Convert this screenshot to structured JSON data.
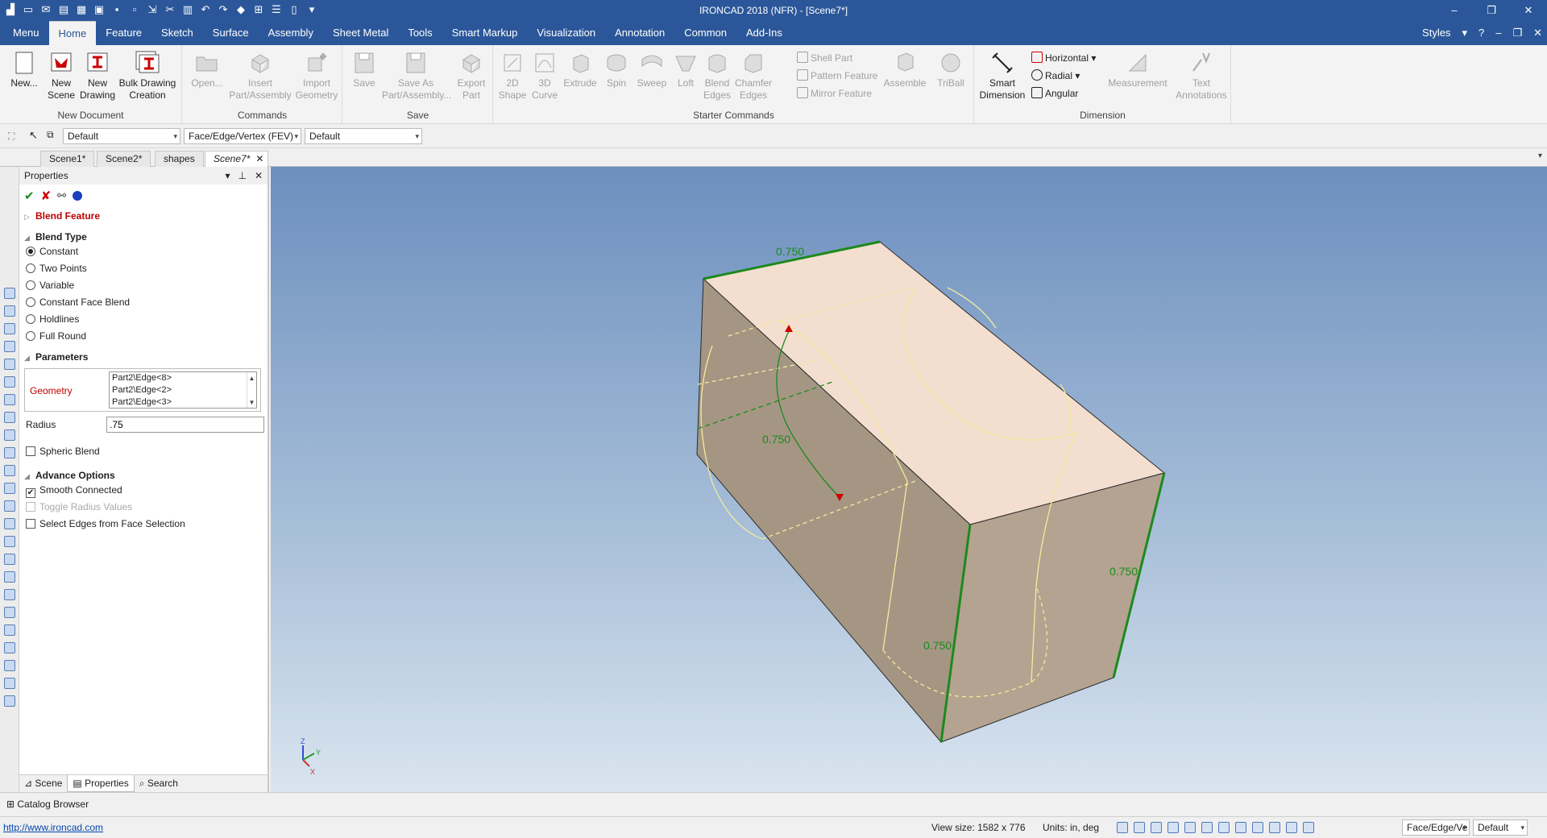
{
  "window": {
    "title": "IRONCAD 2018 (NFR) - [Scene7*]",
    "controls": [
      "–",
      "❐",
      "✕"
    ]
  },
  "ribbon_tabs": [
    "Menu",
    "Home",
    "Feature",
    "Sketch",
    "Surface",
    "Assembly",
    "Sheet Metal",
    "Tools",
    "Smart Markup",
    "Visualization",
    "Annotation",
    "Common",
    "Add-Ins"
  ],
  "ribbon_right": {
    "styles": "Styles"
  },
  "groups": {
    "new_document": {
      "label": "New Document",
      "new": "New...",
      "new_scene": [
        "New",
        "Scene"
      ],
      "new_drawing": [
        "New",
        "Drawing"
      ],
      "bulk_drawing": [
        "Bulk Drawing",
        "Creation"
      ]
    },
    "commands": {
      "label": "Commands",
      "open": "Open...",
      "insert": [
        "Insert",
        "Part/Assembly"
      ],
      "import": [
        "Import",
        "Geometry"
      ]
    },
    "save": {
      "label": "Save",
      "save": "Save",
      "save_as": [
        "Save As",
        "Part/Assembly..."
      ],
      "export": [
        "Export",
        "Part"
      ]
    },
    "starter": {
      "label": "Starter Commands",
      "shape2d": [
        "2D",
        "Shape"
      ],
      "curve3d": [
        "3D",
        "Curve"
      ],
      "extrude": "Extrude",
      "spin": "Spin",
      "sweep": "Sweep",
      "loft": "Loft",
      "blend_edges": [
        "Blend",
        "Edges"
      ],
      "chamfer_edges": [
        "Chamfer",
        "Edges"
      ],
      "shell_part": "Shell Part",
      "pattern_feature": "Pattern Feature",
      "mirror_feature": "Mirror Feature",
      "assemble": "Assemble",
      "triball": "TriBall"
    },
    "dimension": {
      "label": "Dimension",
      "smart_dimension": [
        "Smart",
        "Dimension"
      ],
      "horizontal": "Horizontal",
      "radial": "Radial",
      "angular": "Angular",
      "measurement": "Measurement",
      "text_annotations": [
        "Text",
        "Annotations"
      ]
    }
  },
  "selection_toolbar": {
    "combo1": "Default",
    "combo2": "Face/Edge/Vertex (FEV)",
    "combo3": "Default"
  },
  "doc_tabs": [
    "Scene1*",
    "Scene2*",
    "shapes",
    "Scene7*"
  ],
  "properties": {
    "title": "Properties",
    "feature": "Blend Feature",
    "blend_type_label": "Blend Type",
    "blend_types": [
      "Constant",
      "Two Points",
      "Variable",
      "Constant Face Blend",
      "Holdlines",
      "Full Round"
    ],
    "selected_blend_type": "Constant",
    "parameters_label": "Parameters",
    "geometry_label": "Geometry",
    "geometry_items": [
      "Part2\\Edge<8>",
      "Part2\\Edge<2>",
      "Part2\\Edge<3>"
    ],
    "radius_label": "Radius",
    "radius_value": ".75",
    "spheric_blend": "Spheric Blend",
    "advance_options_label": "Advance Options",
    "smooth_connected": "Smooth Connected",
    "toggle_radius": "Toggle Radius Values",
    "select_edges": "Select Edges from Face Selection",
    "bottom_tabs": [
      "Scene",
      "Properties",
      "Search"
    ]
  },
  "viewport": {
    "dimension_labels": [
      "0.750",
      "0.750",
      "0.750",
      "0.750"
    ],
    "axes": {
      "x": "X",
      "y": "Y",
      "z": "Z"
    },
    "colors": {
      "highlight_edge": "#1c8a1c",
      "preview_curve": "#f5eea0",
      "top_face": "#f3ded0",
      "side_face": "#b3a290"
    }
  },
  "catalog": {
    "label": "Catalog Browser"
  },
  "status": {
    "link": "http://www.ironcad.com",
    "view_size": "View size: 1582 x  776",
    "units": "Units: in, deg",
    "combo1": "Face/Edge/Ve",
    "combo2": "Default"
  }
}
